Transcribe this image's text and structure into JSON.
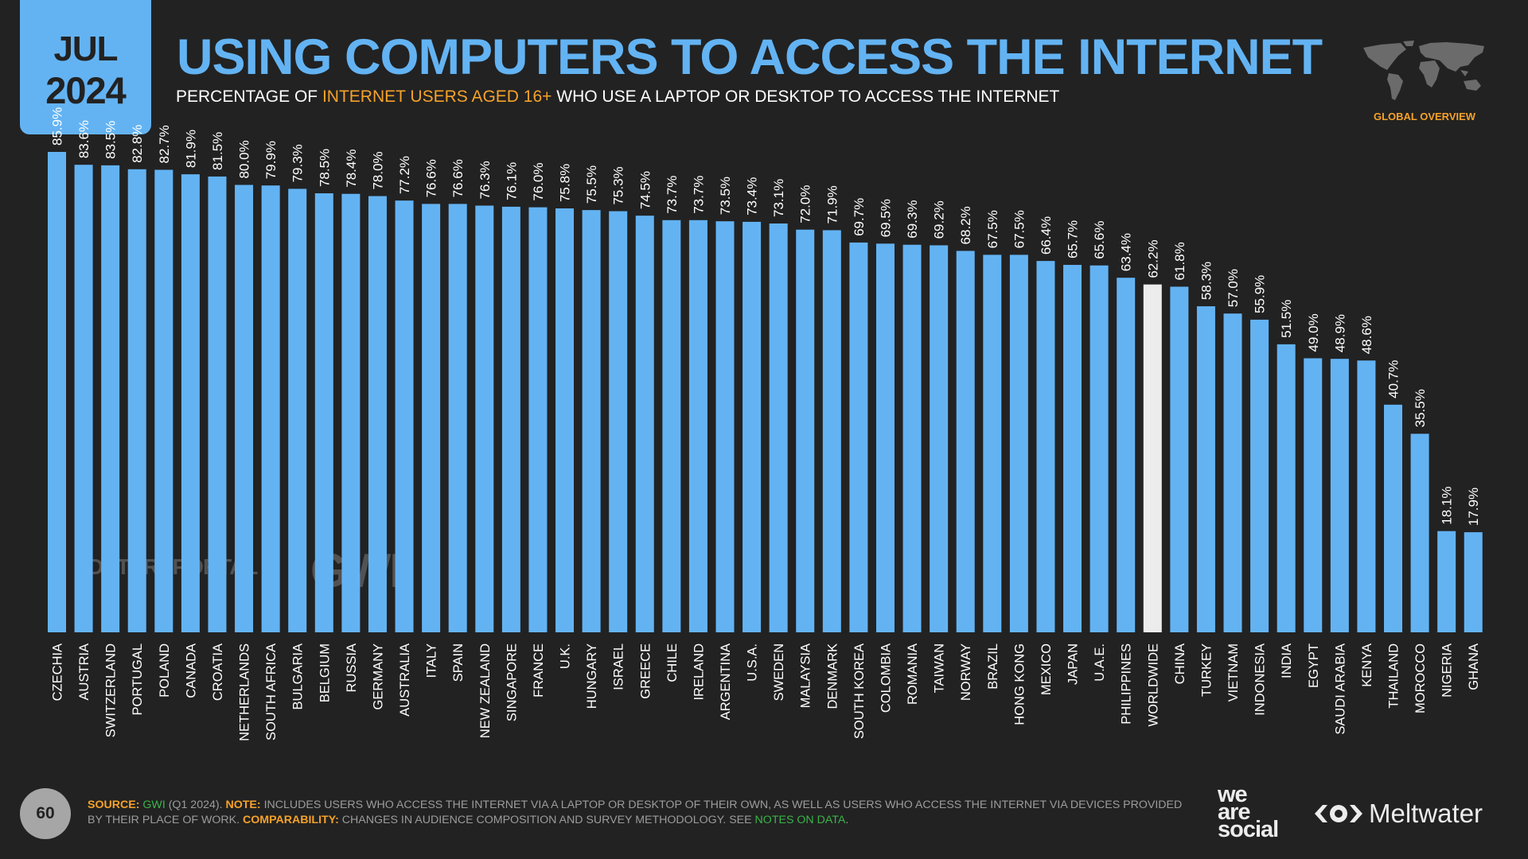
{
  "header": {
    "month": "JUL",
    "year": "2024",
    "title": "USING COMPUTERS TO ACCESS THE INTERNET",
    "subtitle_pre": "PERCENTAGE OF ",
    "subtitle_highlight": "INTERNET USERS AGED 16+",
    "subtitle_post": " WHO USE A LAPTOP OR DESKTOP TO ACCESS THE INTERNET",
    "section_label": "GLOBAL OVERVIEW",
    "globe_icon": "world-map-icon"
  },
  "colors": {
    "background": "#222222",
    "bar": "#63b3f3",
    "highlight_bar": "#ececec",
    "accent": "#f6a22a",
    "link": "#3ab54a"
  },
  "watermarks": {
    "datareportal": "DATAREPORTAL",
    "gwi": "GWI."
  },
  "chart_data": {
    "type": "bar",
    "title": "USING COMPUTERS TO ACCESS THE INTERNET",
    "xlabel": "",
    "ylabel": "Percentage of internet users aged 16+",
    "ylim": [
      0,
      100
    ],
    "grid": false,
    "value_suffix": "%",
    "highlight": "WORLDWIDE",
    "categories": [
      "CZECHIA",
      "AUSTRIA",
      "SWITZERLAND",
      "PORTUGAL",
      "POLAND",
      "CANADA",
      "CROATIA",
      "NETHERLANDS",
      "SOUTH AFRICA",
      "BULGARIA",
      "BELGIUM",
      "RUSSIA",
      "GERMANY",
      "AUSTRALIA",
      "ITALY",
      "SPAIN",
      "NEW ZEALAND",
      "SINGAPORE",
      "FRANCE",
      "U.K.",
      "HUNGARY",
      "ISRAEL",
      "GREECE",
      "CHILE",
      "IRELAND",
      "ARGENTINA",
      "U.S.A.",
      "SWEDEN",
      "MALAYSIA",
      "DENMARK",
      "SOUTH KOREA",
      "COLOMBIA",
      "ROMANIA",
      "TAIWAN",
      "NORWAY",
      "BRAZIL",
      "HONG KONG",
      "MEXICO",
      "JAPAN",
      "U.A.E.",
      "PHILIPPINES",
      "WORLDWIDE",
      "CHINA",
      "TURKEY",
      "VIETNAM",
      "INDONESIA",
      "INDIA",
      "EGYPT",
      "SAUDI ARABIA",
      "KENYA",
      "THAILAND",
      "MOROCCO",
      "NIGERIA",
      "GHANA"
    ],
    "values": [
      85.9,
      83.6,
      83.5,
      82.8,
      82.7,
      81.9,
      81.5,
      80.0,
      79.9,
      79.3,
      78.5,
      78.4,
      78.0,
      77.2,
      76.6,
      76.6,
      76.3,
      76.1,
      76.0,
      75.8,
      75.5,
      75.3,
      74.5,
      73.7,
      73.7,
      73.5,
      73.4,
      73.1,
      72.0,
      71.9,
      69.7,
      69.5,
      69.3,
      69.2,
      68.2,
      67.5,
      67.5,
      66.4,
      65.7,
      65.6,
      63.4,
      62.2,
      61.8,
      58.3,
      57.0,
      55.9,
      51.5,
      49.0,
      48.9,
      48.6,
      40.7,
      35.5,
      18.1,
      17.9
    ],
    "labels": [
      "85.9%",
      "83.6%",
      "83.5%",
      "82.8%",
      "82.7%",
      "81.9%",
      "81.5%",
      "80.0%",
      "79.9%",
      "79.3%",
      "78.5%",
      "78.4%",
      "78.0%",
      "77.2%",
      "76.6%",
      "76.6%",
      "76.3%",
      "76.1%",
      "76.0%",
      "75.8%",
      "75.5%",
      "75.3%",
      "74.5%",
      "73.7%",
      "73.7%",
      "73.5%",
      "73.4%",
      "73.1%",
      "72.0%",
      "71.9%",
      "69.7%",
      "69.5%",
      "69.3%",
      "69.2%",
      "68.2%",
      "67.5%",
      "67.5%",
      "66.4%",
      "65.7%",
      "65.6%",
      "63.4%",
      "62.2%",
      "61.8%",
      "58.3%",
      "57.0%",
      "55.9%",
      "51.5%",
      "49.0%",
      "48.9%",
      "48.6%",
      "40.7%",
      "35.5%",
      "18.1%",
      "17.9%"
    ]
  },
  "footer": {
    "page_number": "60",
    "source_label": "SOURCE:",
    "source_link": "GWI",
    "source_rest": " (Q1 2024). ",
    "note_label": "NOTE:",
    "note_text": " INCLUDES USERS WHO ACCESS THE INTERNET VIA A LAPTOP OR DESKTOP OF THEIR OWN, AS WELL AS USERS WHO ACCESS THE INTERNET VIA DEVICES PROVIDED BY THEIR PLACE OF WORK. ",
    "comparability_label": "COMPARABILITY:",
    "comparability_text": " CHANGES IN AUDIENCE COMPOSITION AND SURVEY METHODOLOGY. SEE ",
    "notes_link": "NOTES ON DATA",
    "end": ".",
    "logo_was_1": "we",
    "logo_was_2": "are",
    "logo_was_3": "social",
    "logo_meltwater": "Meltwater"
  }
}
